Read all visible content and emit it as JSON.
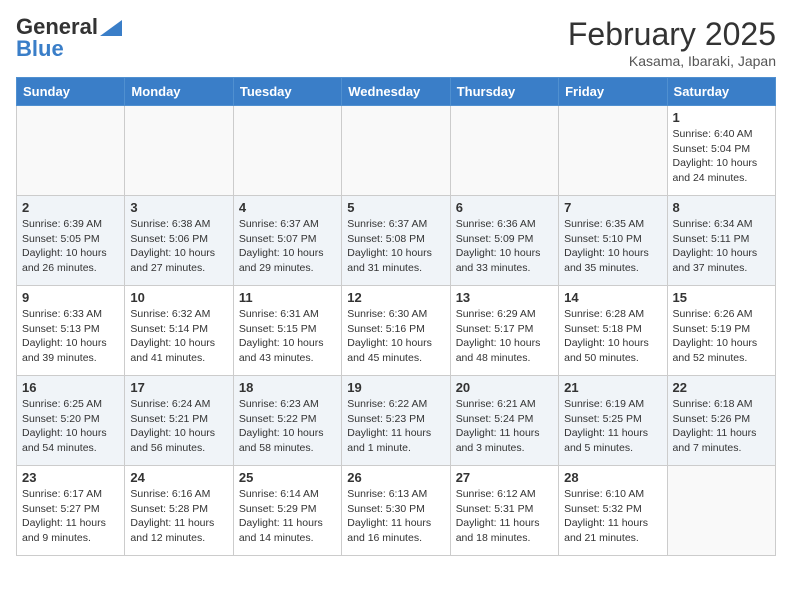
{
  "header": {
    "logo_line1": "General",
    "logo_line2": "Blue",
    "month_title": "February 2025",
    "location": "Kasama, Ibaraki, Japan"
  },
  "days_of_week": [
    "Sunday",
    "Monday",
    "Tuesday",
    "Wednesday",
    "Thursday",
    "Friday",
    "Saturday"
  ],
  "weeks": [
    [
      {
        "num": "",
        "info": ""
      },
      {
        "num": "",
        "info": ""
      },
      {
        "num": "",
        "info": ""
      },
      {
        "num": "",
        "info": ""
      },
      {
        "num": "",
        "info": ""
      },
      {
        "num": "",
        "info": ""
      },
      {
        "num": "1",
        "info": "Sunrise: 6:40 AM\nSunset: 5:04 PM\nDaylight: 10 hours and 24 minutes."
      }
    ],
    [
      {
        "num": "2",
        "info": "Sunrise: 6:39 AM\nSunset: 5:05 PM\nDaylight: 10 hours and 26 minutes."
      },
      {
        "num": "3",
        "info": "Sunrise: 6:38 AM\nSunset: 5:06 PM\nDaylight: 10 hours and 27 minutes."
      },
      {
        "num": "4",
        "info": "Sunrise: 6:37 AM\nSunset: 5:07 PM\nDaylight: 10 hours and 29 minutes."
      },
      {
        "num": "5",
        "info": "Sunrise: 6:37 AM\nSunset: 5:08 PM\nDaylight: 10 hours and 31 minutes."
      },
      {
        "num": "6",
        "info": "Sunrise: 6:36 AM\nSunset: 5:09 PM\nDaylight: 10 hours and 33 minutes."
      },
      {
        "num": "7",
        "info": "Sunrise: 6:35 AM\nSunset: 5:10 PM\nDaylight: 10 hours and 35 minutes."
      },
      {
        "num": "8",
        "info": "Sunrise: 6:34 AM\nSunset: 5:11 PM\nDaylight: 10 hours and 37 minutes."
      }
    ],
    [
      {
        "num": "9",
        "info": "Sunrise: 6:33 AM\nSunset: 5:13 PM\nDaylight: 10 hours and 39 minutes."
      },
      {
        "num": "10",
        "info": "Sunrise: 6:32 AM\nSunset: 5:14 PM\nDaylight: 10 hours and 41 minutes."
      },
      {
        "num": "11",
        "info": "Sunrise: 6:31 AM\nSunset: 5:15 PM\nDaylight: 10 hours and 43 minutes."
      },
      {
        "num": "12",
        "info": "Sunrise: 6:30 AM\nSunset: 5:16 PM\nDaylight: 10 hours and 45 minutes."
      },
      {
        "num": "13",
        "info": "Sunrise: 6:29 AM\nSunset: 5:17 PM\nDaylight: 10 hours and 48 minutes."
      },
      {
        "num": "14",
        "info": "Sunrise: 6:28 AM\nSunset: 5:18 PM\nDaylight: 10 hours and 50 minutes."
      },
      {
        "num": "15",
        "info": "Sunrise: 6:26 AM\nSunset: 5:19 PM\nDaylight: 10 hours and 52 minutes."
      }
    ],
    [
      {
        "num": "16",
        "info": "Sunrise: 6:25 AM\nSunset: 5:20 PM\nDaylight: 10 hours and 54 minutes."
      },
      {
        "num": "17",
        "info": "Sunrise: 6:24 AM\nSunset: 5:21 PM\nDaylight: 10 hours and 56 minutes."
      },
      {
        "num": "18",
        "info": "Sunrise: 6:23 AM\nSunset: 5:22 PM\nDaylight: 10 hours and 58 minutes."
      },
      {
        "num": "19",
        "info": "Sunrise: 6:22 AM\nSunset: 5:23 PM\nDaylight: 11 hours and 1 minute."
      },
      {
        "num": "20",
        "info": "Sunrise: 6:21 AM\nSunset: 5:24 PM\nDaylight: 11 hours and 3 minutes."
      },
      {
        "num": "21",
        "info": "Sunrise: 6:19 AM\nSunset: 5:25 PM\nDaylight: 11 hours and 5 minutes."
      },
      {
        "num": "22",
        "info": "Sunrise: 6:18 AM\nSunset: 5:26 PM\nDaylight: 11 hours and 7 minutes."
      }
    ],
    [
      {
        "num": "23",
        "info": "Sunrise: 6:17 AM\nSunset: 5:27 PM\nDaylight: 11 hours and 9 minutes."
      },
      {
        "num": "24",
        "info": "Sunrise: 6:16 AM\nSunset: 5:28 PM\nDaylight: 11 hours and 12 minutes."
      },
      {
        "num": "25",
        "info": "Sunrise: 6:14 AM\nSunset: 5:29 PM\nDaylight: 11 hours and 14 minutes."
      },
      {
        "num": "26",
        "info": "Sunrise: 6:13 AM\nSunset: 5:30 PM\nDaylight: 11 hours and 16 minutes."
      },
      {
        "num": "27",
        "info": "Sunrise: 6:12 AM\nSunset: 5:31 PM\nDaylight: 11 hours and 18 minutes."
      },
      {
        "num": "28",
        "info": "Sunrise: 6:10 AM\nSunset: 5:32 PM\nDaylight: 11 hours and 21 minutes."
      },
      {
        "num": "",
        "info": ""
      }
    ]
  ]
}
